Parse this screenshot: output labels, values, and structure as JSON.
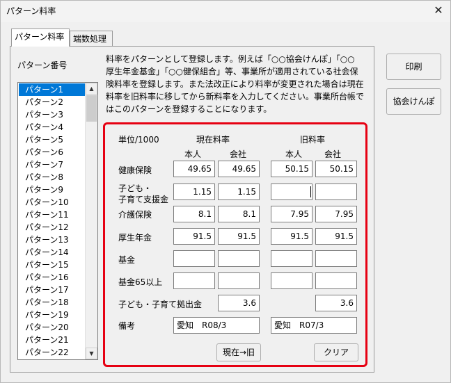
{
  "window": {
    "title": "パターン料率",
    "close_glyph": "✕"
  },
  "tabs": [
    {
      "label": "パターン料率"
    },
    {
      "label": "端数処理"
    }
  ],
  "pattern_list": {
    "label": "パターン番号",
    "items": [
      "パターン1",
      "パターン2",
      "パターン3",
      "パターン4",
      "パターン5",
      "パターン6",
      "パターン7",
      "パターン8",
      "パターン9",
      "パターン10",
      "パターン11",
      "パターン12",
      "パターン13",
      "パターン14",
      "パターン15",
      "パターン16",
      "パターン17",
      "パターン18",
      "パターン19",
      "パターン20",
      "パターン21",
      "パターン22"
    ],
    "selected": "パターン1",
    "scroll_up": "▲",
    "scroll_down": "▼"
  },
  "description": [
    "料率をパターンとして登録します。例えば「○○協会けんぽ」「○○",
    "厚生年金基金」「○○健保組合」等、事業所が適用されている社会保",
    "険料率を登録します。また法改正により料率が変更された場合は現在",
    "料率を旧料率に移してから新料率を入力してください。事業所台帳で",
    "はこのパターンを登録することになります。"
  ],
  "rates": {
    "unit_label": "単位/1000",
    "current_header": "現在料率",
    "old_header": "旧料率",
    "col_person": "本人",
    "col_company": "会社",
    "rows": {
      "health": {
        "label": "健康保険",
        "cur_person": "49.65",
        "cur_company": "49.65",
        "old_person": "50.15",
        "old_company": "50.15"
      },
      "child": {
        "label1": "子ども・",
        "label2": "子育て支援金",
        "cur_person": "1.15",
        "cur_company": "1.15",
        "old_person": "",
        "old_company": ""
      },
      "care": {
        "label": "介護保険",
        "cur_person": "8.1",
        "cur_company": "8.1",
        "old_person": "7.95",
        "old_company": "7.95"
      },
      "pension": {
        "label": "厚生年金",
        "cur_person": "91.5",
        "cur_company": "91.5",
        "old_person": "91.5",
        "old_company": "91.5"
      },
      "fund": {
        "label": "基金",
        "cur_person": "",
        "cur_company": "",
        "old_person": "",
        "old_company": ""
      },
      "fund65": {
        "label": "基金65以上",
        "cur_person": "",
        "cur_company": "",
        "old_person": "",
        "old_company": ""
      }
    },
    "contribution": {
      "label": "子ども・子育て拠出金",
      "current": "3.6",
      "old": "3.6"
    },
    "remarks": {
      "label": "備考",
      "current": "愛知　R08/3",
      "old": "愛知　R07/3"
    }
  },
  "buttons": {
    "copy": "現在→旧",
    "clear": "クリア",
    "print": "印刷",
    "kyokai": "協会けんぽ"
  },
  "colors": {
    "highlight_border": "#e60012",
    "selection": "#0078d7"
  }
}
